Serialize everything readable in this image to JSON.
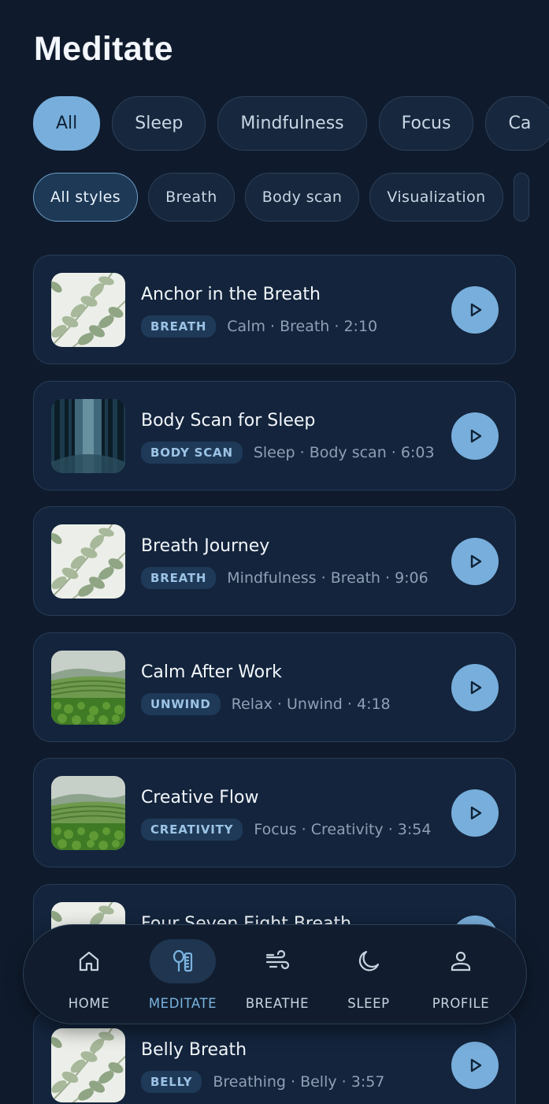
{
  "page": {
    "title": "Meditate"
  },
  "categories": [
    "All",
    "Sleep",
    "Mindfulness",
    "Focus",
    "Ca"
  ],
  "styles": [
    "All styles",
    "Breath",
    "Body scan",
    "Visualization"
  ],
  "sessions": [
    {
      "title": "Anchor in the Breath",
      "tag": "BREATH",
      "meta": "Calm · Breath · 2:10",
      "thumb": "eucalyptus-image"
    },
    {
      "title": "Body Scan for Sleep",
      "tag": "BODY SCAN",
      "meta": "Sleep · Body scan · 6:03",
      "thumb": "forest-image"
    },
    {
      "title": "Breath Journey",
      "tag": "BREATH",
      "meta": "Mindfulness · Breath · 9:06",
      "thumb": "eucalyptus-image"
    },
    {
      "title": "Calm After Work",
      "tag": "UNWIND",
      "meta": "Relax · Unwind · 4:18",
      "thumb": "tea-field-image"
    },
    {
      "title": "Creative Flow",
      "tag": "CREATIVITY",
      "meta": "Focus · Creativity · 3:54",
      "thumb": "tea-field-image"
    },
    {
      "title": "Four Seven Eight Breath",
      "tag": "",
      "meta": "",
      "thumb": "eucalyptus-image"
    },
    {
      "title": "Belly Breath",
      "tag": "BELLY",
      "meta": "Breathing · Belly · 3:57",
      "thumb": "eucalyptus-image"
    }
  ],
  "nav": [
    {
      "label": "HOME",
      "icon": "home-icon"
    },
    {
      "label": "MEDITATE",
      "icon": "meditate-icon",
      "active": true
    },
    {
      "label": "BREATHE",
      "icon": "wind-icon"
    },
    {
      "label": "SLEEP",
      "icon": "moon-icon"
    },
    {
      "label": "PROFILE",
      "icon": "person-icon"
    }
  ],
  "colors": {
    "background": "#0f1b2d",
    "accent": "#78aedb",
    "card": "#13243c",
    "tag": "#1f3a58"
  }
}
